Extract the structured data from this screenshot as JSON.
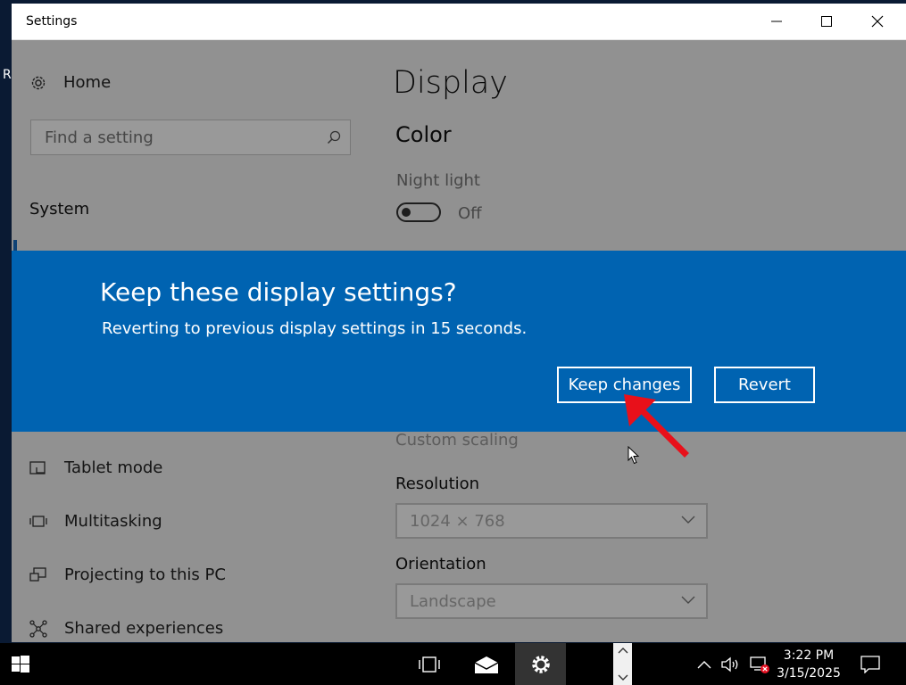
{
  "desktop": {
    "edge_text": "R"
  },
  "window": {
    "title": "Settings",
    "controls": {
      "minimize": "minimize-icon",
      "maximize": "maximize-icon",
      "close": "close-icon"
    }
  },
  "sidebar": {
    "home_label": "Home",
    "search_placeholder": "Find a setting",
    "section_label": "System",
    "items": [
      {
        "label": "Tablet mode",
        "icon": "tablet-mode-icon"
      },
      {
        "label": "Multitasking",
        "icon": "multitasking-icon"
      },
      {
        "label": "Projecting to this PC",
        "icon": "projecting-icon"
      },
      {
        "label": "Shared experiences",
        "icon": "shared-experiences-icon"
      }
    ]
  },
  "main": {
    "page_title": "Display",
    "color_heading": "Color",
    "night_light": {
      "label": "Night light",
      "state": "Off"
    },
    "custom_scaling_link": "Custom scaling",
    "resolution": {
      "label": "Resolution",
      "value": "1024 × 768"
    },
    "orientation": {
      "label": "Orientation",
      "value": "Landscape"
    }
  },
  "dialog": {
    "title": "Keep these display settings?",
    "message": "Reverting to previous display settings in 15 seconds.",
    "keep_label": "Keep changes",
    "revert_label": "Revert",
    "background_color": "#0063b1"
  },
  "annotation": {
    "arrow_color": "#e8101a"
  },
  "taskbar": {
    "time": "3:22 PM",
    "date": "3/15/2025"
  }
}
